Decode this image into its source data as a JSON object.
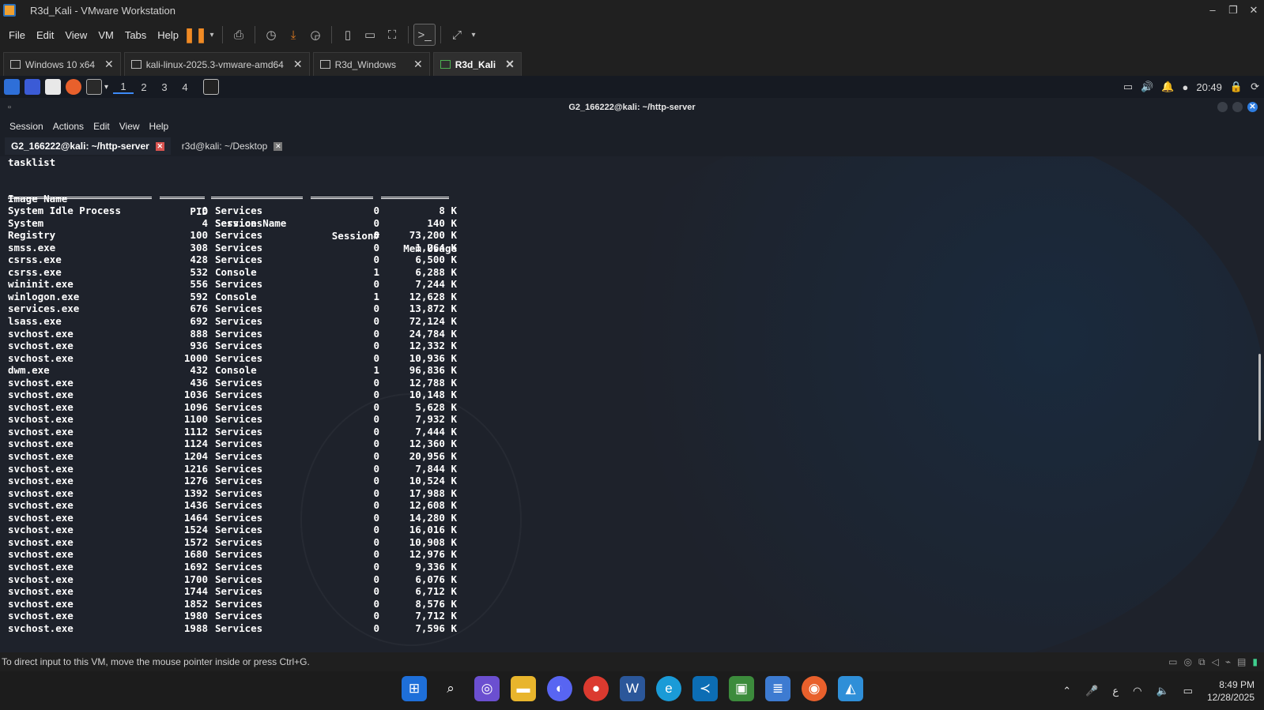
{
  "window": {
    "title": "R3d_Kali - VMware Workstation",
    "controls": [
      "–",
      "❐",
      "✕"
    ]
  },
  "vm_menu": [
    "File",
    "Edit",
    "View",
    "VM",
    "Tabs",
    "Help"
  ],
  "vm_tabs": [
    {
      "label": "Windows 10 x64",
      "active": false
    },
    {
      "label": "kali-linux-2025.3-vmware-amd64",
      "active": false
    },
    {
      "label": "R3d_Windows",
      "active": false
    },
    {
      "label": "R3d_Kali",
      "active": true
    }
  ],
  "kali_panel": {
    "workspaces": [
      "1",
      "2",
      "3",
      "4"
    ],
    "time": "20:49"
  },
  "terminal": {
    "title": "G2_166222@kali: ~/http-server",
    "menu": [
      "Session",
      "Actions",
      "Edit",
      "View",
      "Help"
    ],
    "tabs": [
      {
        "label": "G2_166222@kali: ~/http-server",
        "active": true
      },
      {
        "label": "r3d@kali: ~/Desktop",
        "active": false
      }
    ],
    "command": "tasklist",
    "headers": {
      "image": "Image Name",
      "pid": "PID",
      "session_name": "Session Name",
      "session_num": "Session#",
      "mem": "Mem Usage"
    },
    "rows": [
      [
        "System Idle Process",
        "0",
        "Services",
        "0",
        "8 K"
      ],
      [
        "System",
        "4",
        "Services",
        "0",
        "140 K"
      ],
      [
        "Registry",
        "100",
        "Services",
        "0",
        "73,200 K"
      ],
      [
        "smss.exe",
        "308",
        "Services",
        "0",
        "1,264 K"
      ],
      [
        "csrss.exe",
        "428",
        "Services",
        "0",
        "6,500 K"
      ],
      [
        "csrss.exe",
        "532",
        "Console",
        "1",
        "6,288 K"
      ],
      [
        "wininit.exe",
        "556",
        "Services",
        "0",
        "7,244 K"
      ],
      [
        "winlogon.exe",
        "592",
        "Console",
        "1",
        "12,628 K"
      ],
      [
        "services.exe",
        "676",
        "Services",
        "0",
        "13,872 K"
      ],
      [
        "lsass.exe",
        "692",
        "Services",
        "0",
        "72,124 K"
      ],
      [
        "svchost.exe",
        "888",
        "Services",
        "0",
        "24,784 K"
      ],
      [
        "svchost.exe",
        "936",
        "Services",
        "0",
        "12,332 K"
      ],
      [
        "svchost.exe",
        "1000",
        "Services",
        "0",
        "10,936 K"
      ],
      [
        "dwm.exe",
        "432",
        "Console",
        "1",
        "96,836 K"
      ],
      [
        "svchost.exe",
        "436",
        "Services",
        "0",
        "12,788 K"
      ],
      [
        "svchost.exe",
        "1036",
        "Services",
        "0",
        "10,148 K"
      ],
      [
        "svchost.exe",
        "1096",
        "Services",
        "0",
        "5,628 K"
      ],
      [
        "svchost.exe",
        "1100",
        "Services",
        "0",
        "7,932 K"
      ],
      [
        "svchost.exe",
        "1112",
        "Services",
        "0",
        "7,444 K"
      ],
      [
        "svchost.exe",
        "1124",
        "Services",
        "0",
        "12,360 K"
      ],
      [
        "svchost.exe",
        "1204",
        "Services",
        "0",
        "20,956 K"
      ],
      [
        "svchost.exe",
        "1216",
        "Services",
        "0",
        "7,844 K"
      ],
      [
        "svchost.exe",
        "1276",
        "Services",
        "0",
        "10,524 K"
      ],
      [
        "svchost.exe",
        "1392",
        "Services",
        "0",
        "17,988 K"
      ],
      [
        "svchost.exe",
        "1436",
        "Services",
        "0",
        "12,608 K"
      ],
      [
        "svchost.exe",
        "1464",
        "Services",
        "0",
        "14,280 K"
      ],
      [
        "svchost.exe",
        "1524",
        "Services",
        "0",
        "16,016 K"
      ],
      [
        "svchost.exe",
        "1572",
        "Services",
        "0",
        "10,908 K"
      ],
      [
        "svchost.exe",
        "1680",
        "Services",
        "0",
        "12,976 K"
      ],
      [
        "svchost.exe",
        "1692",
        "Services",
        "0",
        "9,336 K"
      ],
      [
        "svchost.exe",
        "1700",
        "Services",
        "0",
        "6,076 K"
      ],
      [
        "svchost.exe",
        "1744",
        "Services",
        "0",
        "6,712 K"
      ],
      [
        "svchost.exe",
        "1852",
        "Services",
        "0",
        "8,576 K"
      ],
      [
        "svchost.exe",
        "1980",
        "Services",
        "0",
        "7,712 K"
      ],
      [
        "svchost.exe",
        "1988",
        "Services",
        "0",
        "7,596 K"
      ]
    ]
  },
  "status_bar": {
    "message": "To direct input to this VM, move the mouse pointer inside or press Ctrl+G."
  },
  "taskbar": {
    "apps": [
      "start-icon",
      "search-icon",
      "snipping-tool-icon",
      "file-explorer-icon",
      "discord-icon",
      "chrome-icon",
      "word-icon",
      "edge-icon",
      "vscode-icon",
      "vmware-icon",
      "notepad-icon",
      "firefox-icon",
      "photos-icon"
    ],
    "ime": "ع",
    "time": "8:49 PM",
    "date": "12/28/2025"
  },
  "colors": {
    "pause_accent": "#f08a24",
    "active_vm_tab_icon": "#4caf50",
    "terminal_tab_close": "#d9534f",
    "workspace_underline": "#3d8af7"
  }
}
